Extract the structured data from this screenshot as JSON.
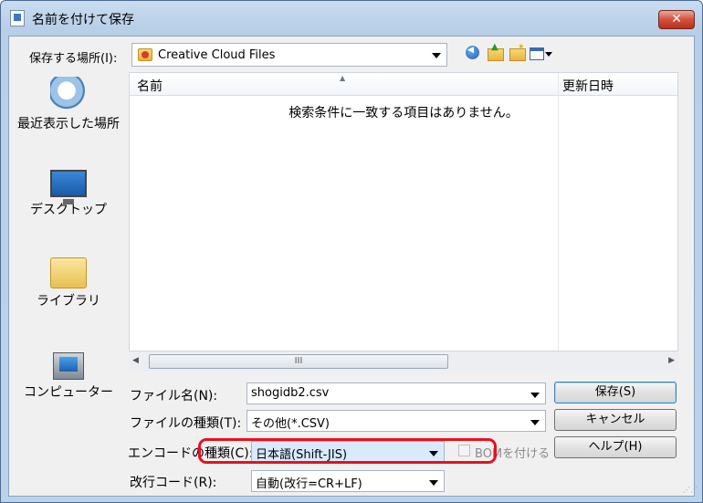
{
  "window": {
    "title": "名前を付けて保存",
    "close_label": "✕"
  },
  "toolbar": {
    "save_in_label": "保存する場所(I):",
    "save_in_value": "Creative Cloud Files"
  },
  "places": [
    "最近表示した場所",
    "デスクトップ",
    "ライブラリ",
    "コンピューター"
  ],
  "file_list": {
    "columns": [
      "名前",
      "更新日時"
    ],
    "empty_message": "検索条件に一致する項目はありません。",
    "scroll_thumb_label": "III"
  },
  "form": {
    "filename_label": "ファイル名(N):",
    "filename_value": "shogidb2.csv",
    "filetype_label": "ファイルの種類(T):",
    "filetype_value": "その他(*.CSV)",
    "encoding_label": "エンコードの種類(C):",
    "encoding_value": "日本語(Shift-JIS)",
    "bom_label": "BOMを付ける",
    "bom_checked": false,
    "newline_label": "改行コード(R):",
    "newline_value": "自動(改行=CR+LF)"
  },
  "buttons": {
    "save": "保存(S)",
    "cancel": "キャンセル",
    "help": "ヘルプ(H)"
  },
  "colors": {
    "highlight": "#e8101e",
    "close_button": "#d4503a"
  }
}
